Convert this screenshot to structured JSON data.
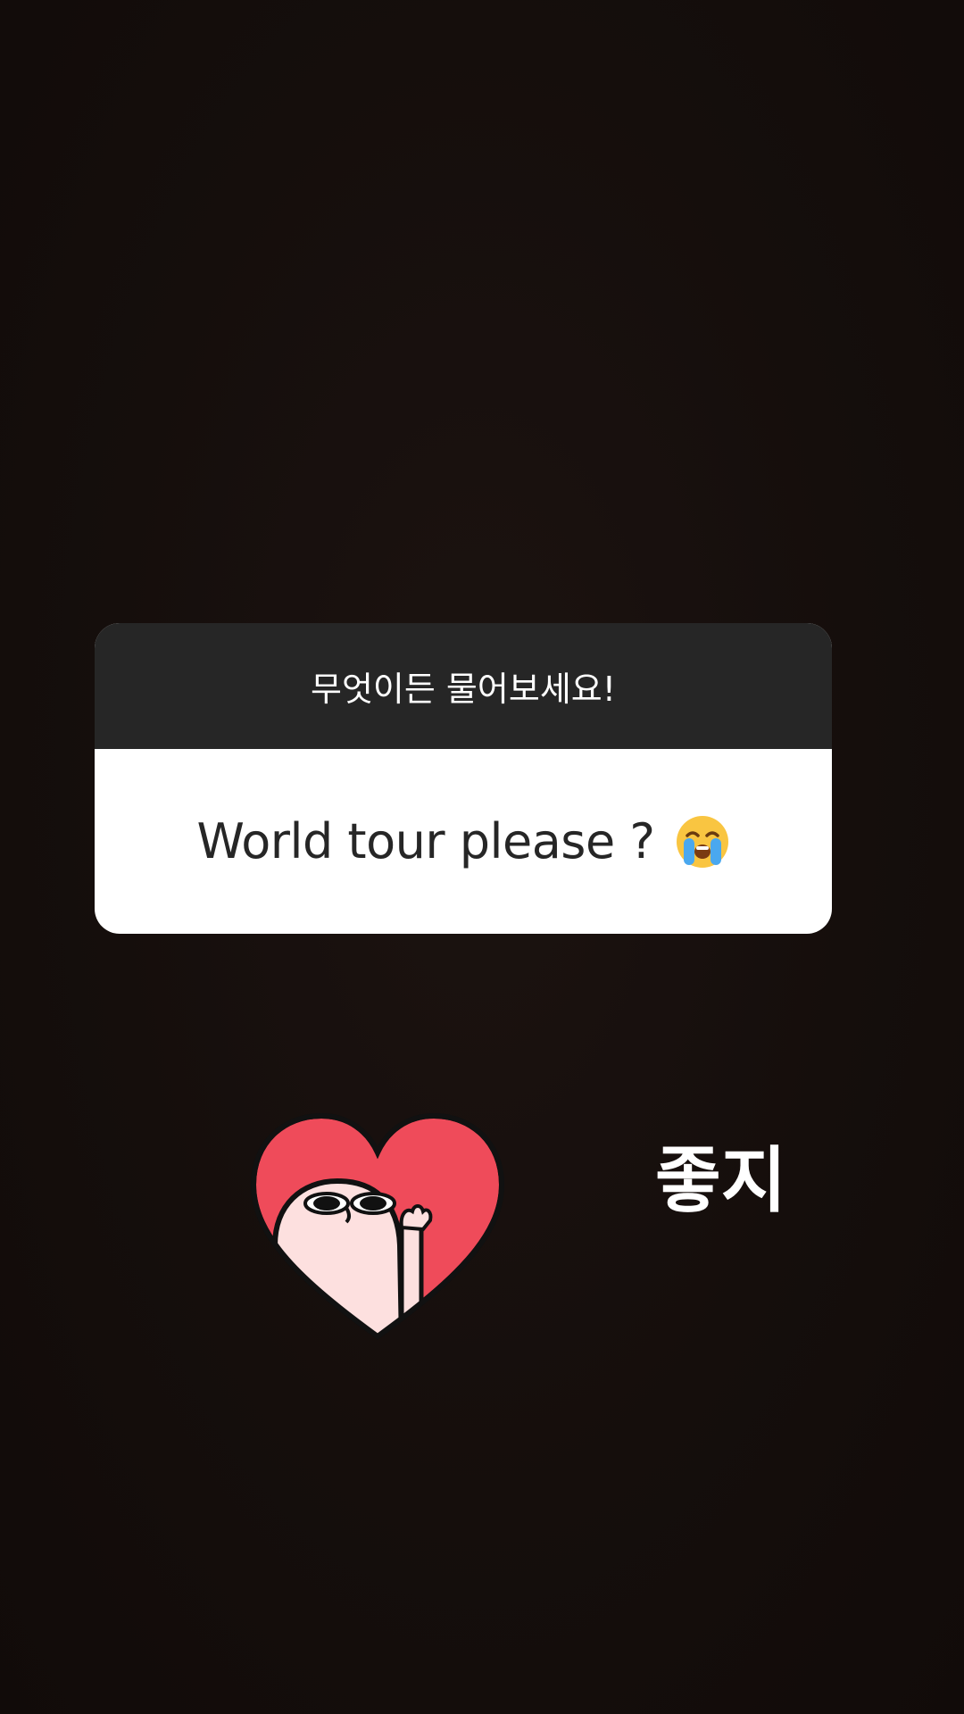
{
  "question_sticker": {
    "prompt": "무엇이든 물어보세요!",
    "answer": "World tour please ?",
    "answer_emoji": "loudly-crying-face-icon"
  },
  "sticker": {
    "icon": "heart-character-sticker-icon"
  },
  "caption": {
    "text": "좋지"
  },
  "colors": {
    "background": "#140d0b",
    "card_header": "#262626",
    "card_body": "#ffffff",
    "heart": "#ef4b5a"
  }
}
